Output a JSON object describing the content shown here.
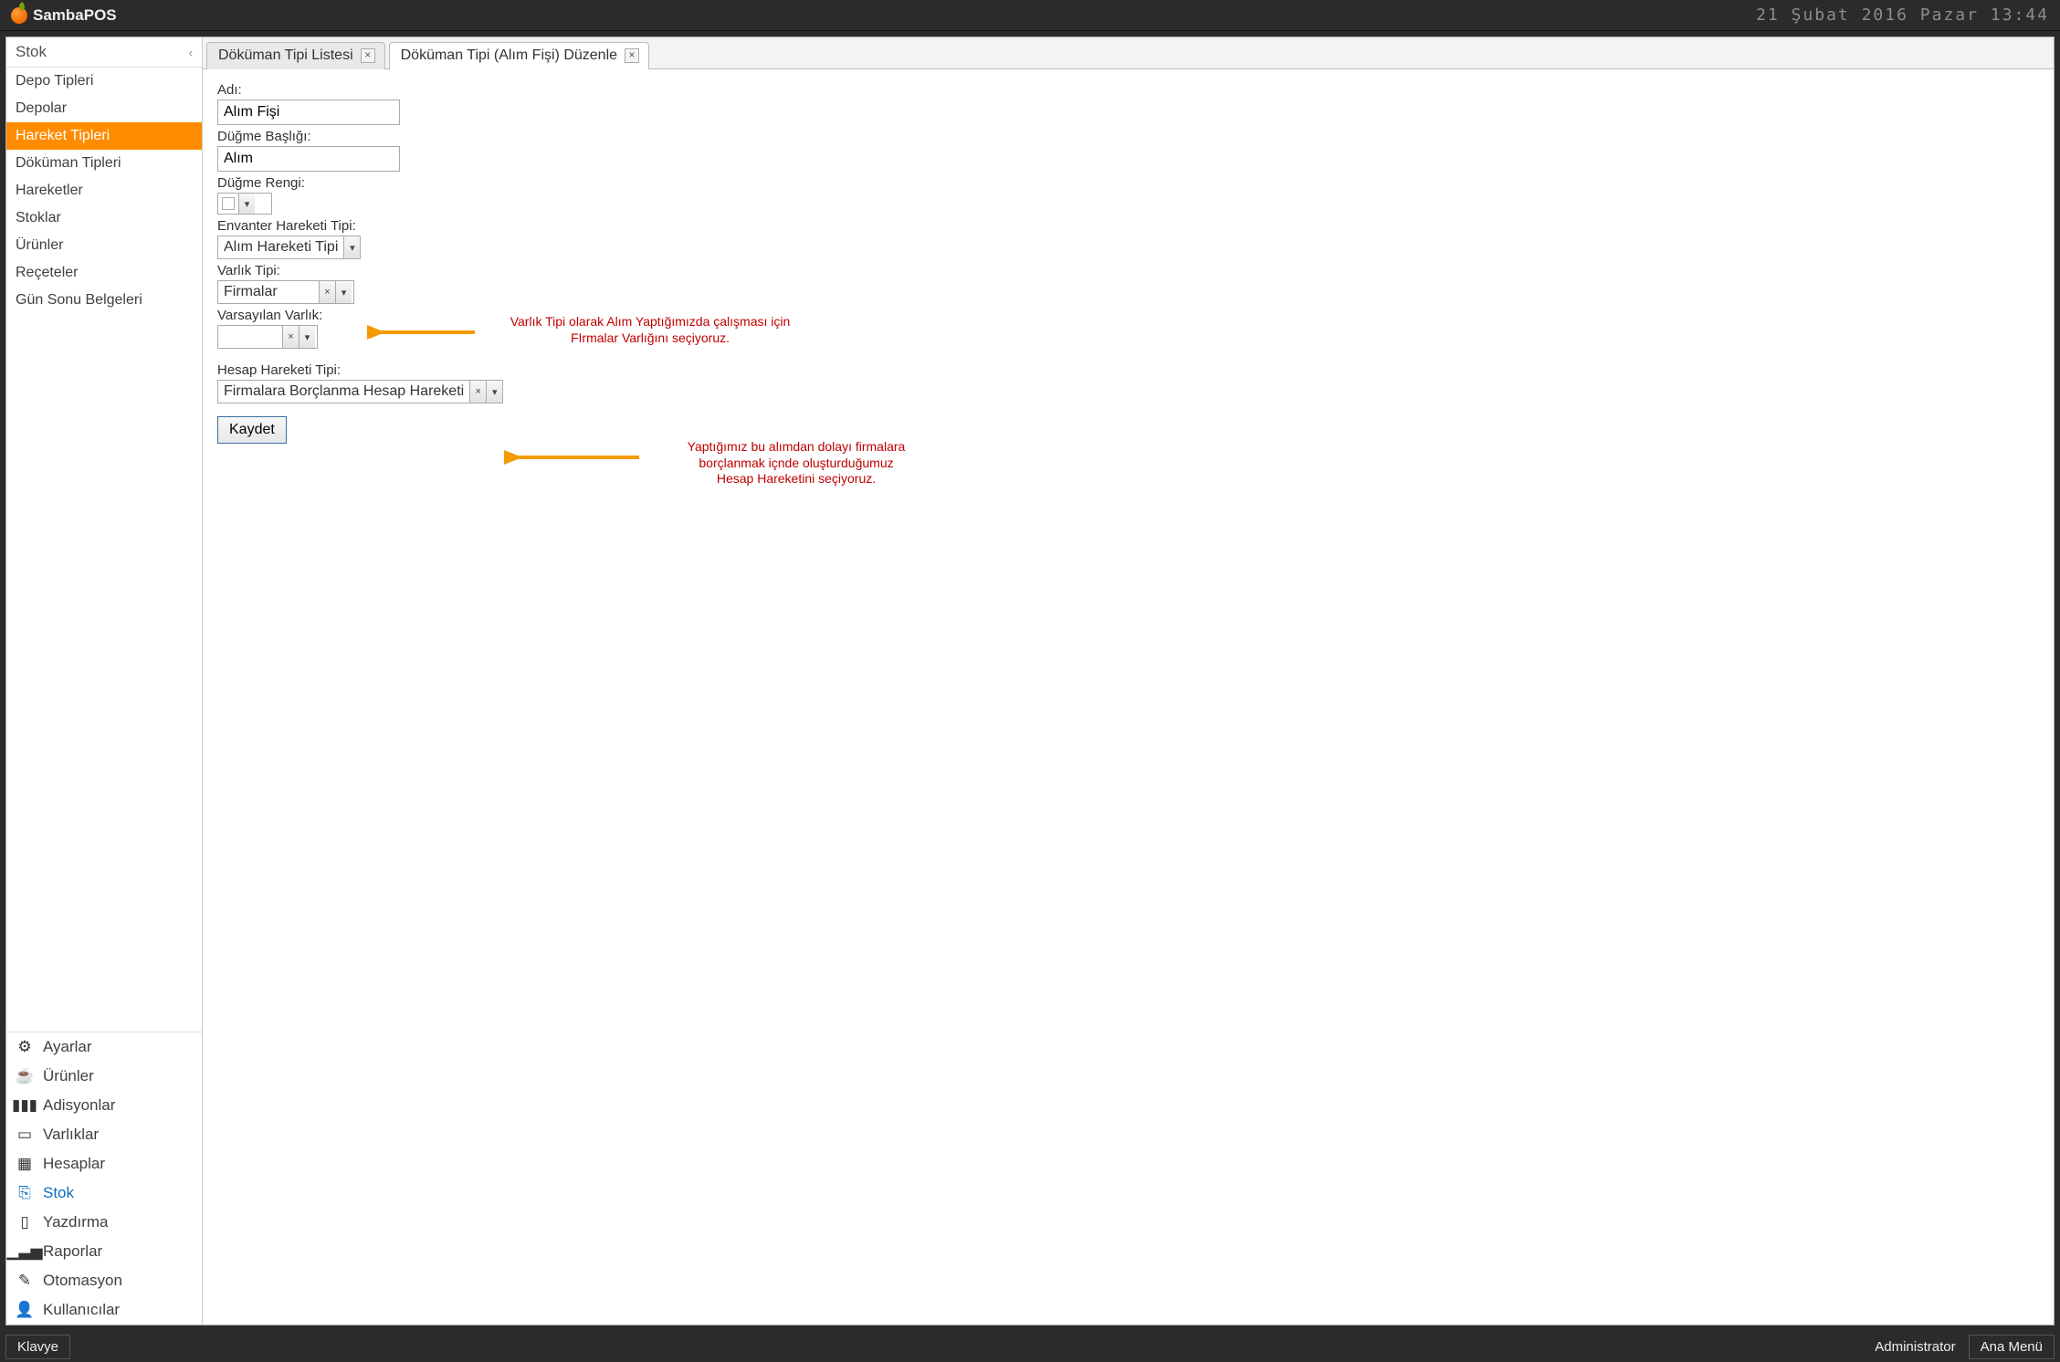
{
  "app": {
    "title": "SambaPOS",
    "datetime": "21 Şubat 2016 Pazar 13:44"
  },
  "sidebar": {
    "header": "Stok",
    "items": [
      {
        "label": "Depo Tipleri"
      },
      {
        "label": "Depolar"
      },
      {
        "label": "Hareket Tipleri",
        "active": true
      },
      {
        "label": "Döküman Tipleri"
      },
      {
        "label": "Hareketler"
      },
      {
        "label": "Stoklar"
      },
      {
        "label": "Ürünler"
      },
      {
        "label": "Reçeteler"
      },
      {
        "label": "Gün Sonu Belgeleri"
      }
    ],
    "modules": [
      {
        "label": "Ayarlar",
        "icon": "gear"
      },
      {
        "label": "Ürünler",
        "icon": "cup"
      },
      {
        "label": "Adisyonlar",
        "icon": "books"
      },
      {
        "label": "Varlıklar",
        "icon": "card"
      },
      {
        "label": "Hesaplar",
        "icon": "grid"
      },
      {
        "label": "Stok",
        "icon": "stock",
        "selected": true
      },
      {
        "label": "Yazdırma",
        "icon": "page"
      },
      {
        "label": "Raporlar",
        "icon": "bars"
      },
      {
        "label": "Otomasyon",
        "icon": "pen"
      },
      {
        "label": "Kullanıcılar",
        "icon": "user"
      }
    ]
  },
  "tabs": [
    {
      "label": "Döküman Tipi Listesi"
    },
    {
      "label": "Döküman Tipi (Alım Fişi) Düzenle",
      "active": true
    }
  ],
  "form": {
    "name_label": "Adı:",
    "name_value": "Alım Fişi",
    "button_title_label": "Düğme Başlığı:",
    "button_title_value": "Alım",
    "button_color_label": "Düğme Rengi:",
    "button_color_value": "",
    "inv_trans_type_label": "Envanter Hareketi Tipi:",
    "inv_trans_type_value": "Alım Hareketi Tipi",
    "entity_type_label": "Varlık Tipi:",
    "entity_type_value": "Firmalar",
    "default_entity_label": "Varsayılan Varlık:",
    "default_entity_value": "",
    "account_trans_type_label": "Hesap Hareketi Tipi:",
    "account_trans_type_value": "Firmalara Borçlanma Hesap Hareketi",
    "save_label": "Kaydet"
  },
  "annotations": {
    "entity_note_l1": "Varlık Tipi olarak Alım Yaptığımızda çalışması için",
    "entity_note_l2": "FIrmalar Varlığını seçiyoruz.",
    "account_note_l1": "Yaptığımız bu alımdan dolayı firmalara",
    "account_note_l2": "borçlanmak içnde oluşturduğumuz",
    "account_note_l3": "Hesap Hareketini seçiyoruz."
  },
  "status": {
    "keyboard": "Klavye",
    "user": "Administrator",
    "main_menu": "Ana Menü"
  },
  "icons": {
    "gear": "⚙",
    "cup": "☕",
    "books": "▮▮▮",
    "card": "▭",
    "grid": "▦",
    "stock": "⎘",
    "page": "▯",
    "bars": "▁▃▅",
    "pen": "✎",
    "user": "👤"
  }
}
